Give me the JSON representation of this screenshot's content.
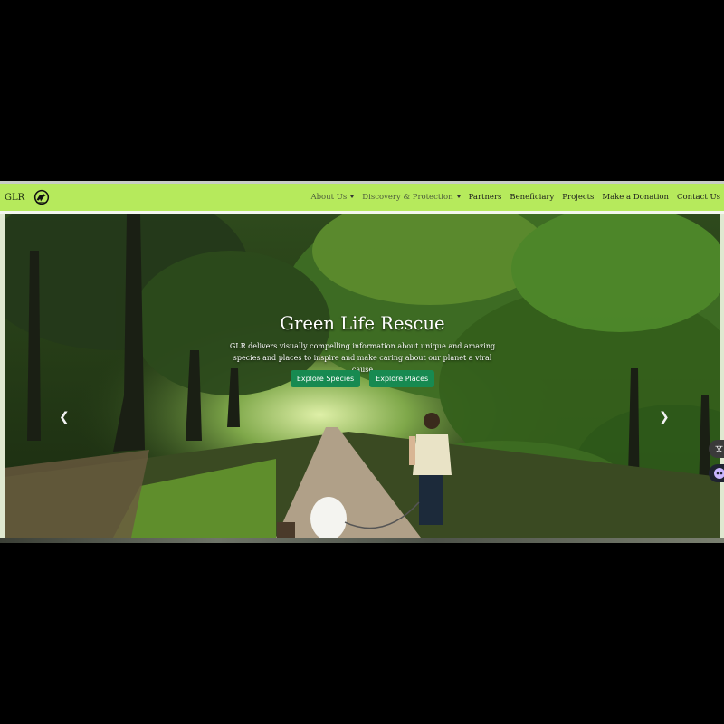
{
  "brand": {
    "name": "GLR",
    "logo_icon": "dinosaur-logo-icon"
  },
  "nav": {
    "items": [
      {
        "label": "About Us",
        "dropdown": true
      },
      {
        "label": "Discovery & Protection",
        "dropdown": true
      },
      {
        "label": "Partners",
        "dropdown": false
      },
      {
        "label": "Beneficiary",
        "dropdown": false
      },
      {
        "label": "Projects",
        "dropdown": false
      },
      {
        "label": "Make a Donation",
        "dropdown": false
      },
      {
        "label": "Contact Us",
        "dropdown": false
      }
    ]
  },
  "hero": {
    "title": "Green Life Rescue",
    "description": "GLR delivers visually compelling information about unique and amazing species and places to inspire and make caring about our planet a viral cause",
    "buttons": {
      "species": "Explore Species",
      "places": "Explore Places"
    },
    "prev_icon": "chevron-left-icon",
    "next_icon": "chevron-right-icon"
  },
  "side_widgets": [
    "translate-icon",
    "assistant-icon"
  ],
  "colors": {
    "navbar": "#b6ea5c",
    "button": "#178a51"
  }
}
